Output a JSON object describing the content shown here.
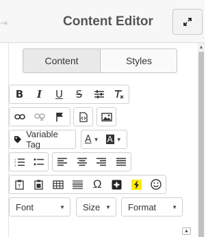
{
  "header": {
    "title": "Content Editor"
  },
  "tabs": [
    {
      "label": "Content",
      "active": true
    },
    {
      "label": "Styles",
      "active": false
    }
  ],
  "toolbar": {
    "bold": "B",
    "italic": "I",
    "underline": "U",
    "strikethrough": "S",
    "omega": "Ω",
    "variable_tag": "Variable Tag",
    "text_color": "A",
    "bg_color": "A",
    "selects": {
      "font": "Font",
      "size": "Size",
      "format": "Format"
    }
  },
  "colors": {
    "highlight_yellow": "#ffeb00",
    "accent_dark": "#222222"
  }
}
